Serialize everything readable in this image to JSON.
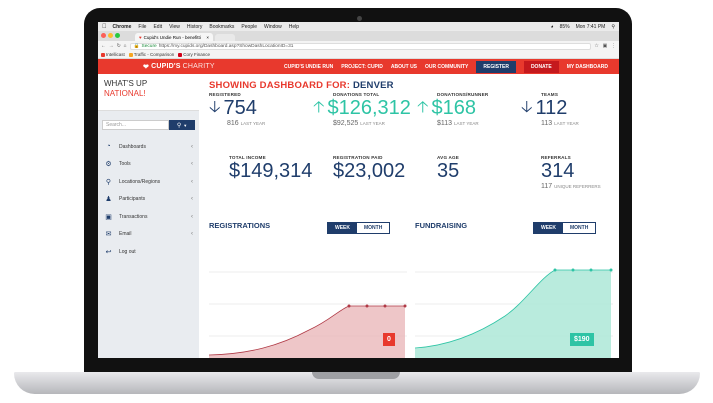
{
  "os_menubar": {
    "app": "Chrome",
    "items": [
      "File",
      "Edit",
      "View",
      "History",
      "Bookmarks",
      "People",
      "Window",
      "Help"
    ],
    "clock": "Mon 7:41 PM",
    "battery": "85%"
  },
  "browser": {
    "tab_title": "Cupid's Undie Run - benefitti",
    "secure_label": "Secure",
    "url": "https://my.cupids.org/Dashboard.asp?ShowDashLocationID=31",
    "bookmarks": [
      "Intellicast",
      "Traffic - Comparison",
      "Cory Finance"
    ]
  },
  "site_nav": {
    "logo_bold": "CUPID'S",
    "logo_light": "CHARITY",
    "items": [
      "CUPID'S UNDIE RUN",
      "PROJECT: CUPID",
      "ABOUT US",
      "OUR COMMUNITY"
    ],
    "register": "REGISTER",
    "donate": "DONATE",
    "dashboard": "MY DASHBOARD"
  },
  "sidebar": {
    "heading_line1": "WHAT'S UP",
    "heading_line2": "NATIONAL!",
    "search_placeholder": "Search...",
    "items": [
      {
        "label": "Dashboards",
        "icon": "dashboard-icon"
      },
      {
        "label": "Tools",
        "icon": "gear-icon"
      },
      {
        "label": "Locations/Regions",
        "icon": "map-pin-icon"
      },
      {
        "label": "Participants",
        "icon": "person-icon"
      },
      {
        "label": "Transactions",
        "icon": "money-icon"
      },
      {
        "label": "Email",
        "icon": "envelope-icon"
      },
      {
        "label": "Log out",
        "icon": "logout-icon"
      }
    ]
  },
  "dashboard": {
    "showing_label": "SHOWING DASHBOARD FOR:",
    "city": "DENVER",
    "stats": {
      "registered": {
        "label": "REGISTERED",
        "value": "754",
        "prev": "816",
        "prev_label": "LAST YEAR",
        "trend": "down"
      },
      "donations_total": {
        "label": "DONATIONS TOTAL",
        "value": "$126,312",
        "prev": "$92,525",
        "prev_label": "LAST YEAR",
        "trend": "up"
      },
      "donations_runner": {
        "label": "DONATIONS/RUNNER",
        "value": "$168",
        "prev": "$113",
        "prev_label": "LAST YEAR",
        "trend": "up"
      },
      "teams": {
        "label": "TEAMS",
        "value": "112",
        "prev": "113",
        "prev_label": "LAST YEAR",
        "trend": "down"
      },
      "total_income": {
        "label": "TOTAL INCOME",
        "value": "$149,314"
      },
      "registration_paid": {
        "label": "REGISTRATION PAID",
        "value": "$23,002"
      },
      "avg_age": {
        "label": "AVG AGE",
        "value": "35"
      },
      "referrals": {
        "label": "REFERRALS",
        "value": "314",
        "sub_value": "117",
        "sub_label": "UNIQUE REFERRERS"
      }
    },
    "registrations": {
      "title": "REGISTRATIONS",
      "week": "WEEK",
      "month": "MONTH",
      "badge": "0"
    },
    "fundraising": {
      "title": "FUNDRAISING",
      "week": "WEEK",
      "month": "MONTH",
      "badge": "$190"
    }
  },
  "colors": {
    "brand_red": "#e8392d",
    "navy": "#1f3d6b",
    "teal": "#2ec4a5"
  }
}
